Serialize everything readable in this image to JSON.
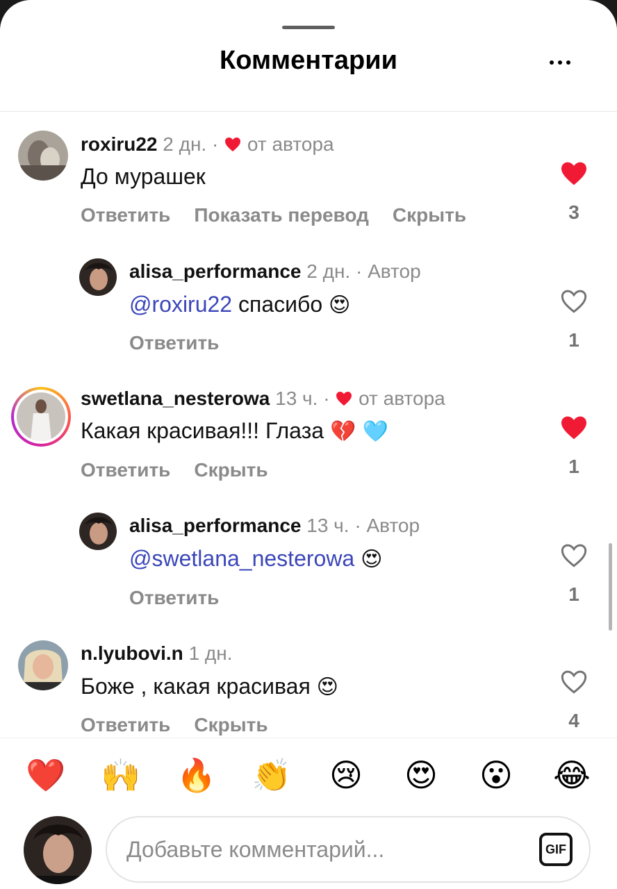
{
  "header": {
    "title": "Комментарии"
  },
  "comments": [
    {
      "username": "roxiru22",
      "time": "2 дн.",
      "dot": "·",
      "author_like": "от автора",
      "text": "До мурашек",
      "actions": [
        "Ответить",
        "Показать перевод",
        "Скрыть"
      ],
      "likes": "3",
      "liked": true
    },
    {
      "username": "alisa_performance",
      "time": "2 дн.",
      "dot": "·",
      "badge": "Автор",
      "mention": "@roxiru22",
      "text": "спасибо",
      "emoji": "😍",
      "actions": [
        "Ответить"
      ],
      "likes": "1",
      "liked": false
    },
    {
      "username": "swetlana_nesterowa",
      "time": "13 ч.",
      "dot": "·",
      "author_like": "от автора",
      "text": "Какая красивая!!! Глаза",
      "emoji": "💔 🩵",
      "actions": [
        "Ответить",
        "Скрыть"
      ],
      "likes": "1",
      "liked": true
    },
    {
      "username": "alisa_performance",
      "time": "13 ч.",
      "dot": "·",
      "badge": "Автор",
      "mention": "@swetlana_nesterowa",
      "emoji": "😍",
      "actions": [
        "Ответить"
      ],
      "likes": "1",
      "liked": false
    },
    {
      "username": "n.lyubovi.n",
      "time": "1 дн.",
      "text": "Боже , какая красивая",
      "emoji": "😍",
      "actions": [
        "Ответить",
        "Скрыть"
      ],
      "likes": "4",
      "liked": false
    }
  ],
  "reactions": [
    "❤️",
    "🙌",
    "🔥",
    "👏",
    "😢",
    "😍",
    "😮",
    "😂"
  ],
  "composer": {
    "placeholder": "Добавьте комментарий...",
    "gif_label": "GIF"
  },
  "colors": {
    "like_red": "#f01a35",
    "mention_blue": "#3b46b9",
    "muted_text": "#8a8a8a"
  }
}
